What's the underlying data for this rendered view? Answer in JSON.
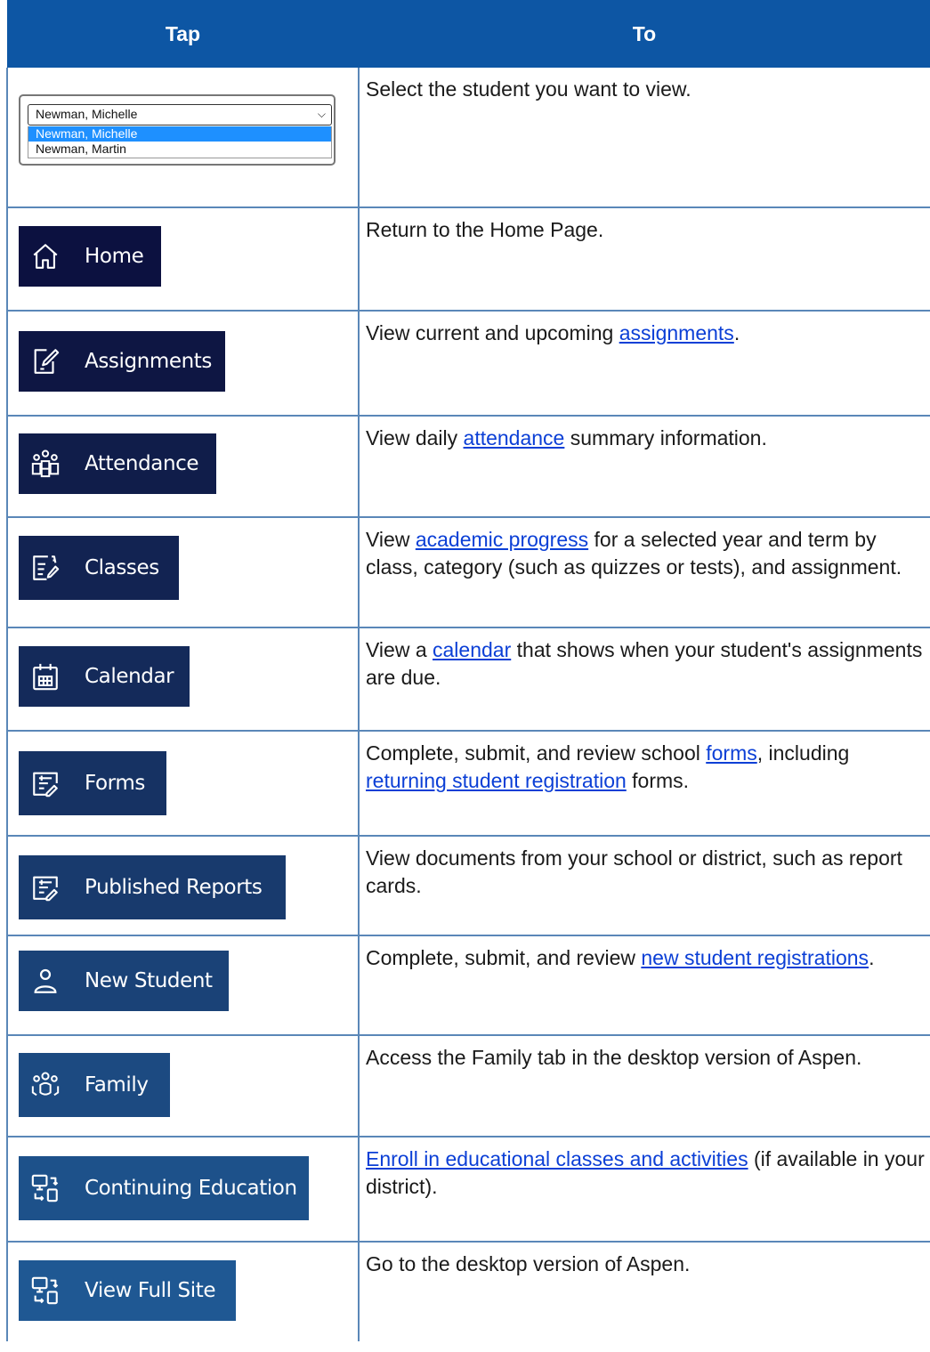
{
  "header": {
    "col1": "Tap",
    "col2": "To"
  },
  "select": {
    "current": "Newman, Michelle",
    "options": [
      "Newman, Michelle",
      "Newman, Martin"
    ]
  },
  "rows": [
    {
      "desc": "Select the student you want to view."
    },
    {
      "label": "Home",
      "icon": "home-icon",
      "color": "#0c1140",
      "desc": "Return to the Home Page."
    },
    {
      "label": "Assignments",
      "icon": "edit-note-icon",
      "color": "#0e1643",
      "pre": "View current and upcoming ",
      "link": "assignments",
      "post": "."
    },
    {
      "label": "Attendance",
      "icon": "people-group-icon",
      "color": "#101d4a",
      "pre": "View daily ",
      "link": "attendance",
      "post": " summary information."
    },
    {
      "label": "Classes",
      "icon": "gradebook-icon",
      "color": "#122352",
      "pre": "View ",
      "link": "academic progress",
      "post": " for a selected year and term by class, category (such as quizzes or tests), and assignment."
    },
    {
      "label": "Calendar",
      "icon": "calendar-icon",
      "color": "#142a5a",
      "pre": "View a ",
      "link": "calendar",
      "post": " that shows when your student's assignments are due."
    },
    {
      "label": "Forms",
      "icon": "form-icon",
      "color": "#163263",
      "pre": "Complete, submit, and review school ",
      "link": "forms",
      "mid": ", including ",
      "link2": "returning student registration",
      "post": " forms."
    },
    {
      "label": "Published Reports",
      "icon": "document-list-icon",
      "color": "#183a6d",
      "desc": "View documents from your school or district, such as report cards."
    },
    {
      "label": "New Student",
      "icon": "person-icon",
      "color": "#1a4277",
      "pre": "Complete, submit, and review ",
      "link": "new student registrations",
      "post": "."
    },
    {
      "label": "Family",
      "icon": "family-icon",
      "color": "#1c4a81",
      "desc": "Access the Family tab in the desktop version of Aspen."
    },
    {
      "label": "Continuing Education",
      "icon": "switch-device-icon",
      "color": "#1d518a",
      "link": "Enroll in educational classes and activities",
      "post": " (if available in your district)."
    },
    {
      "label": "View Full Site",
      "icon": "switch-device-icon",
      "color": "#1f5893",
      "desc": "Go to the desktop version of Aspen."
    }
  ]
}
